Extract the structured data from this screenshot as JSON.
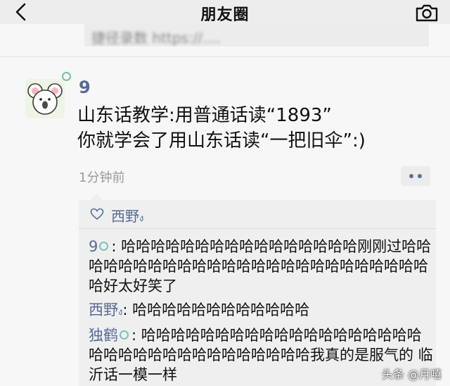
{
  "header": {
    "title": "朋友圈"
  },
  "previous_post": {
    "link_text": "捷径录数 https://...."
  },
  "post": {
    "author": "9",
    "lines": [
      "山东话教学:用普通话读“1893”",
      "你就学会了用山东话读“一把旧伞”:)"
    ],
    "time": "1分钟前"
  },
  "likes": {
    "names": "西野",
    "suffix": "ง"
  },
  "comments": [
    {
      "name": "9",
      "text": ": 哈哈哈哈哈哈哈哈哈哈哈哈哈哈哈哈刚刚过哈哈哈哈哈哈哈哈哈哈哈哈哈哈哈哈哈哈哈哈哈哈哈哈哈哈好太好笑了"
    },
    {
      "name": "西野",
      "suffix": "ง",
      "text": ": 哈哈哈哈哈哈哈哈哈哈哈哈"
    },
    {
      "name": "独鹤",
      "text": ": 哈哈哈哈哈哈哈哈哈哈哈哈哈哈哈哈哈哈哈哈哈哈哈哈哈哈哈哈哈哈哈哈哈哈我真的是服气的 临沂话一模一样"
    }
  ],
  "watermark": "头条 @月嘻",
  "icons": {
    "back": "chevron-left-icon",
    "camera": "camera-icon",
    "like": "heart-icon",
    "more": "more-icon"
  },
  "colors": {
    "name_blue": "#566b96",
    "background": "#f7f7f7",
    "comment_bg": "#efefef"
  }
}
